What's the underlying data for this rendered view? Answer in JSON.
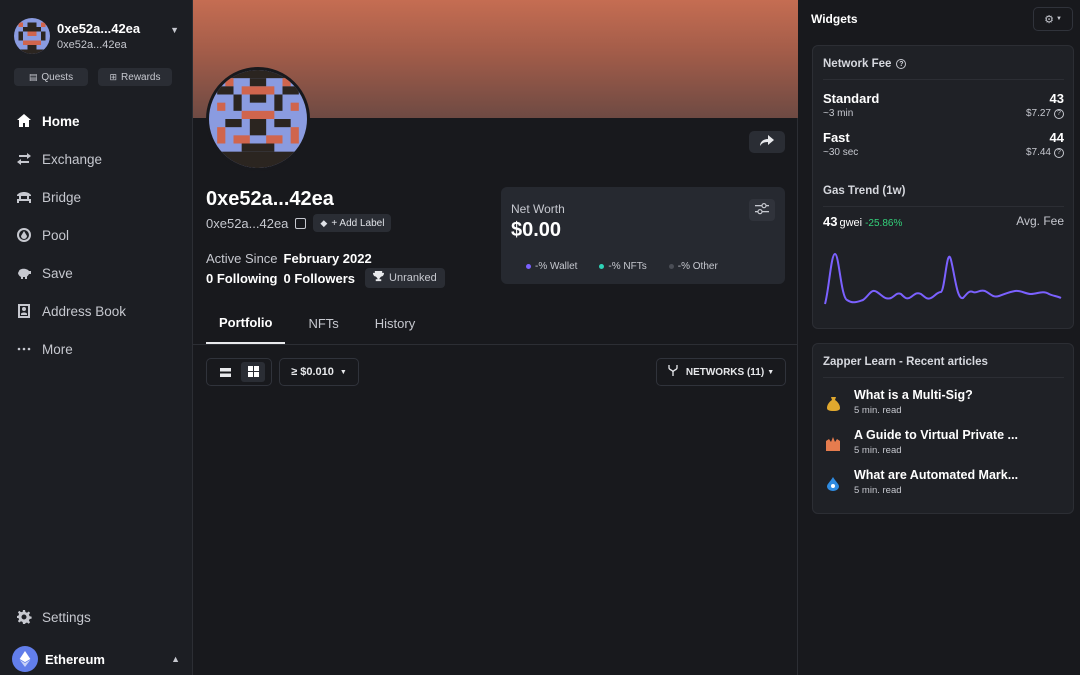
{
  "sidebar": {
    "account": {
      "name": "0xe52a...42ea",
      "address": "0xe52a...42ea"
    },
    "pills": {
      "quests": "Quests",
      "rewards": "Rewards"
    },
    "nav": [
      {
        "label": "Home",
        "icon": "home-icon"
      },
      {
        "label": "Exchange",
        "icon": "exchange-icon"
      },
      {
        "label": "Bridge",
        "icon": "bridge-icon"
      },
      {
        "label": "Pool",
        "icon": "pool-icon"
      },
      {
        "label": "Save",
        "icon": "piggy-bank-icon"
      },
      {
        "label": "Address Book",
        "icon": "address-book-icon"
      },
      {
        "label": "More",
        "icon": "more-icon"
      }
    ],
    "settings": "Settings",
    "network": "Ethereum"
  },
  "profile": {
    "name": "0xe52a...42ea",
    "address": "0xe52a...42ea",
    "add_label": "+ Add Label",
    "active_since_label": "Active Since",
    "active_since": "February 2022",
    "following": "0 Following",
    "followers": "0 Followers",
    "rank": "Unranked"
  },
  "networth": {
    "label": "Net Worth",
    "value": "$0.00",
    "legend": [
      {
        "label": "-% Wallet",
        "color": "#7b61ff"
      },
      {
        "label": "-% NFTs",
        "color": "#2ed3b7"
      },
      {
        "label": "-% Other",
        "color": "#4a4d55"
      }
    ]
  },
  "tabs": [
    "Portfolio",
    "NFTs",
    "History"
  ],
  "toolbar": {
    "min_value": "≥ $0.010",
    "networks": "NETWORKS (11)"
  },
  "widgets": {
    "title": "Widgets",
    "network_fee": {
      "title": "Network Fee",
      "rows": [
        {
          "name": "Standard",
          "time": "~3 min",
          "gwei": "43",
          "usd": "$7.27"
        },
        {
          "name": "Fast",
          "time": "~30 sec",
          "gwei": "44",
          "usd": "$7.44"
        }
      ],
      "gas_trend_title": "Gas Trend (1w)",
      "gwei_now": "43",
      "gwei_unit": "gwei",
      "change": "-25.86%",
      "avg_label": "Avg. Fee",
      "trend_color": "#7b61ff"
    },
    "learn": {
      "title": "Zapper Learn - Recent articles",
      "articles": [
        {
          "title": "What is a Multi-Sig?",
          "read": "5 min. read",
          "icon": "money-bag-icon"
        },
        {
          "title": "A Guide to Virtual Private ...",
          "read": "5 min. read",
          "icon": "shield-icon"
        },
        {
          "title": "What are Automated Mark...",
          "read": "5 min. read",
          "icon": "droplet-icon"
        }
      ]
    }
  }
}
